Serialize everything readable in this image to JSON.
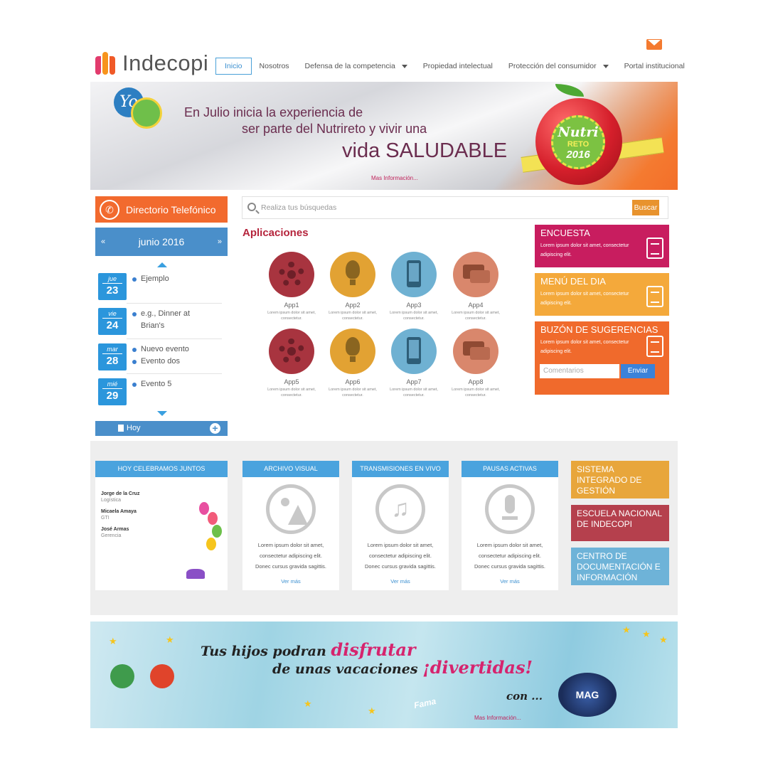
{
  "header": {
    "logo_text": "Indecopi",
    "nav": [
      {
        "label": "Inicio",
        "active": true,
        "dropdown": false
      },
      {
        "label": "Nosotros",
        "active": false,
        "dropdown": false
      },
      {
        "label": "Defensa de la competencia",
        "active": false,
        "dropdown": true
      },
      {
        "label": "Propiedad intelectual",
        "active": false,
        "dropdown": false
      },
      {
        "label": "Protección del consumidor",
        "active": false,
        "dropdown": true
      },
      {
        "label": "Portal institucional",
        "active": false,
        "dropdown": false
      }
    ],
    "mail_icon": "mail-icon"
  },
  "hero": {
    "badge_text": "Yo",
    "line1": "En Julio inicia la experiencia de",
    "line2": "ser parte del Nutrireto y vivir una",
    "line3": "vida SALUDABLE",
    "more": "Mas Información...",
    "seal_1": "Nutri",
    "seal_2": "RETO",
    "seal_3": "2016"
  },
  "directory": {
    "label": "Directorio Telefónico",
    "icon": "phone-icon"
  },
  "calendar": {
    "month": "junio 2016",
    "prev": "«",
    "next": "»",
    "events": [
      {
        "dow": "jue",
        "day": "23",
        "items": [
          "Ejemplo"
        ]
      },
      {
        "dow": "vie",
        "day": "24",
        "items": [
          "e.g., Dinner at Brian's"
        ]
      },
      {
        "dow": "mar",
        "day": "28",
        "items": [
          "Nuevo evento",
          "Evento dos"
        ]
      },
      {
        "dow": "mié",
        "day": "29",
        "items": [
          "Evento 5"
        ]
      }
    ],
    "today": "Hoy",
    "add": "+"
  },
  "search": {
    "placeholder": "Realiza tus búsquedas",
    "button": "Buscar"
  },
  "apps": {
    "title": "Aplicaciones",
    "desc": "Lorem ipsum dolor sit amet, consectetur.",
    "items": [
      {
        "name": "App1",
        "color": "#a8343f",
        "icon": "gear-icon"
      },
      {
        "name": "App2",
        "color": "#e2a233",
        "icon": "bulb-icon"
      },
      {
        "name": "App3",
        "color": "#6fb1d2",
        "icon": "phone-icon"
      },
      {
        "name": "App4",
        "color": "#d9876c",
        "icon": "chat-icon"
      },
      {
        "name": "App5",
        "color": "#a8343f",
        "icon": "gear-icon"
      },
      {
        "name": "App6",
        "color": "#e2a233",
        "icon": "bulb-icon"
      },
      {
        "name": "App7",
        "color": "#6fb1d2",
        "icon": "phone-icon"
      },
      {
        "name": "App8",
        "color": "#d9876c",
        "icon": "chat-icon"
      }
    ]
  },
  "side_boxes": {
    "encuesta": {
      "title": "ENCUESTA",
      "text": "Lorem ipsum dolor sit amet, consectetur adipiscing elit.",
      "color": "#c81d5f"
    },
    "menu": {
      "title": "MENÚ DEL DIA",
      "text": "Lorem ipsum dolor sit amet, consectetur adipiscing elit.",
      "color": "#f4a93b"
    },
    "buzon": {
      "title": "BUZÓN DE SUGERENCIAS",
      "text": "Lorem ipsum dolor sit amet, consectetur adipiscing elit.",
      "color": "#f06a2c",
      "input_placeholder": "Comentarios",
      "button": "Enviar"
    }
  },
  "birthdays": {
    "title": "HOY CELEBRAMOS JUNTOS",
    "people": [
      {
        "name": "Jorge de la Cruz",
        "area": "Logística"
      },
      {
        "name": "Micaela Amaya",
        "area": "GTI"
      },
      {
        "name": "José Armas",
        "area": "Gerencia"
      }
    ]
  },
  "media_cards": [
    {
      "title": "ARCHIVO VISUAL",
      "icon": "image-icon",
      "text": [
        "Lorem ipsum dolor sit amet,",
        "consectetur adipiscing elit.",
        "Donec cursus gravida sagittis."
      ],
      "more": "Ver más"
    },
    {
      "title": "TRANSMISIONES EN VIVO",
      "icon": "music-icon",
      "text": [
        "Lorem ipsum dolor sit amet,",
        "consectetur adipiscing elit.",
        "Donec cursus gravida sagittis."
      ],
      "more": "Ver más"
    },
    {
      "title": "PAUSAS ACTIVAS",
      "icon": "microphone-icon",
      "text": [
        "Lorem ipsum dolor sit amet,",
        "consectetur adipiscing elit.",
        "Donec cursus gravida sagittis."
      ],
      "more": "Ver más"
    }
  ],
  "side_links": [
    {
      "label": "SISTEMA INTEGRADO DE GESTIÓN",
      "color": "#e8a63b"
    },
    {
      "label": "ESCUELA NACIONAL DE INDECOPI",
      "color": "#b5404d"
    },
    {
      "label": "CENTRO DE DOCUMENTACIÓN E INFORMACIÓN",
      "color": "#6eb3d8"
    }
  ],
  "promo": {
    "line1_a": "Tus hijos podran ",
    "line1_b": "disfrutar",
    "line2_a": "de unas vacaciones ",
    "line2_b": "¡divertidas!",
    "con": "con ...",
    "logo": "MAG SCIENCE",
    "fama": "Fama",
    "more": "Mas Información..."
  }
}
